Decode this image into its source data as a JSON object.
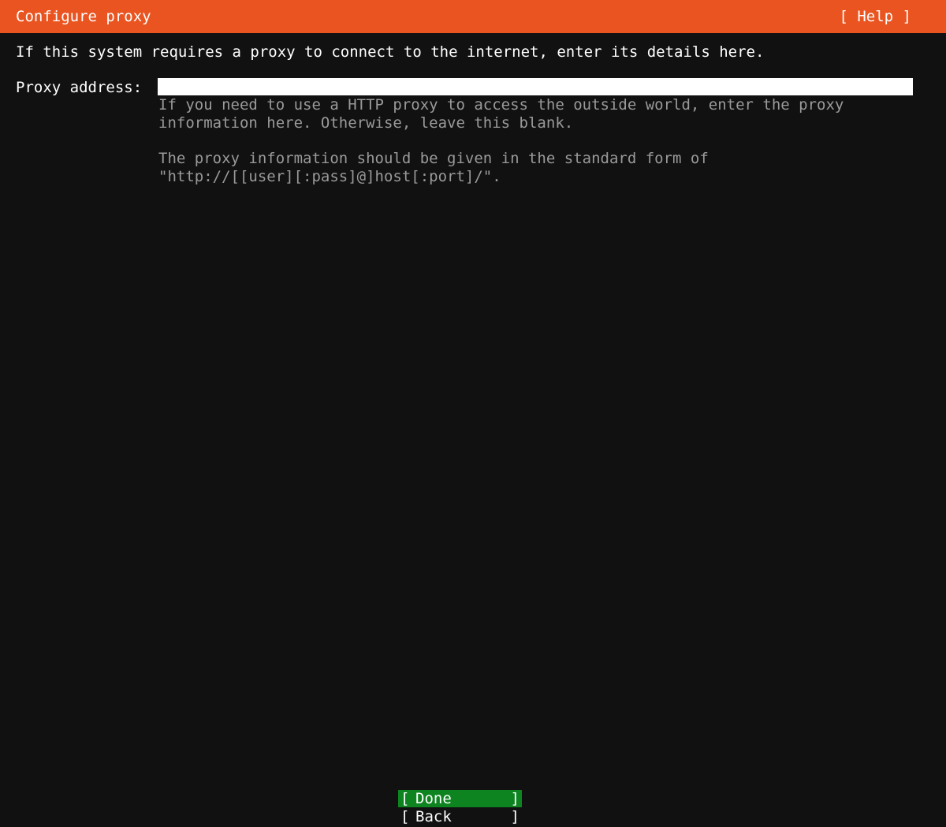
{
  "header": {
    "title": "Configure proxy",
    "help_label": "[ Help ]",
    "color": "#e95420"
  },
  "intro": "If this system requires a proxy to connect to the internet, enter its details here.",
  "proxy": {
    "label": "Proxy address:",
    "value": "",
    "help_lines_1": "If you need to use a HTTP proxy to access the outside world, enter the proxy\ninformation here. Otherwise, leave this blank.",
    "help_lines_2": "The proxy information should be given in the standard form of\n\"http://[[user][:pass]@]host[:port]/\"."
  },
  "buttons": {
    "bracket_left": "[",
    "bracket_right": "]",
    "done_label": "Done",
    "back_label": "Back",
    "done_color": "#0e8420"
  },
  "colors": {
    "background": "#111111",
    "muted_text": "#9a9a9a"
  }
}
